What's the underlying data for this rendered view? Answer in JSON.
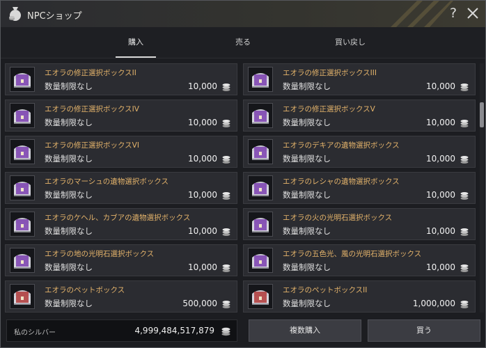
{
  "window": {
    "title": "NPCショップ",
    "help_label": "?"
  },
  "tabs": [
    {
      "label": "購入",
      "active": true
    },
    {
      "label": "売る",
      "active": false
    },
    {
      "label": "買い戻し",
      "active": false
    }
  ],
  "items": [
    {
      "name": "エオラの修正選択ボックスII",
      "limit": "数量制限なし",
      "price": "10,000",
      "icon": "purple-chest-icon"
    },
    {
      "name": "エオラの修正選択ボックスIII",
      "limit": "数量制限なし",
      "price": "10,000",
      "icon": "purple-chest-icon"
    },
    {
      "name": "エオラの修正選択ボックスIV",
      "limit": "数量制限なし",
      "price": "10,000",
      "icon": "purple-chest-icon"
    },
    {
      "name": "エオラの修正選択ボックスV",
      "limit": "数量制限なし",
      "price": "10,000",
      "icon": "purple-chest-icon"
    },
    {
      "name": "エオラの修正選択ボックスVI",
      "limit": "数量制限なし",
      "price": "10,000",
      "icon": "purple-chest-icon"
    },
    {
      "name": "エオラのデキアの遺物選択ボックス",
      "limit": "数量制限なし",
      "price": "10,000",
      "icon": "purple-chest-icon"
    },
    {
      "name": "エオラのマーシュの遺物選択ボックス",
      "limit": "数量制限なし",
      "price": "10,000",
      "icon": "purple-chest-icon"
    },
    {
      "name": "エオラのレシャの遺物選択ボックス",
      "limit": "数量制限なし",
      "price": "10,000",
      "icon": "purple-chest-icon"
    },
    {
      "name": "エオラのケヘル、カブアの遺物選択ボックス",
      "limit": "数量制限なし",
      "price": "10,000",
      "icon": "purple-chest-icon"
    },
    {
      "name": "エオラの火の光明石選択ボックス",
      "limit": "数量制限なし",
      "price": "10,000",
      "icon": "purple-chest-icon"
    },
    {
      "name": "エオラの地の光明石選択ボックス",
      "limit": "数量制限なし",
      "price": "10,000",
      "icon": "purple-chest-icon"
    },
    {
      "name": "エオラの五色光、風の光明石選択ボックス",
      "limit": "数量制限なし",
      "price": "10,000",
      "icon": "purple-chest-icon"
    },
    {
      "name": "エオラのペットボックス",
      "limit": "数量制限なし",
      "price": "500,000",
      "icon": "red-chest-icon"
    },
    {
      "name": "エオラのペットボックスII",
      "limit": "数量制限なし",
      "price": "1,000,000",
      "icon": "red-chest-icon"
    }
  ],
  "footer": {
    "silver_label": "私のシルバー",
    "silver_value": "4,999,484,517,879",
    "bulk_buy_label": "複数購入",
    "buy_label": "買う"
  },
  "colors": {
    "item_name": "#e5b46b",
    "accent_chest": "#7b3fb0",
    "pet_chest": "#b03a3a"
  }
}
